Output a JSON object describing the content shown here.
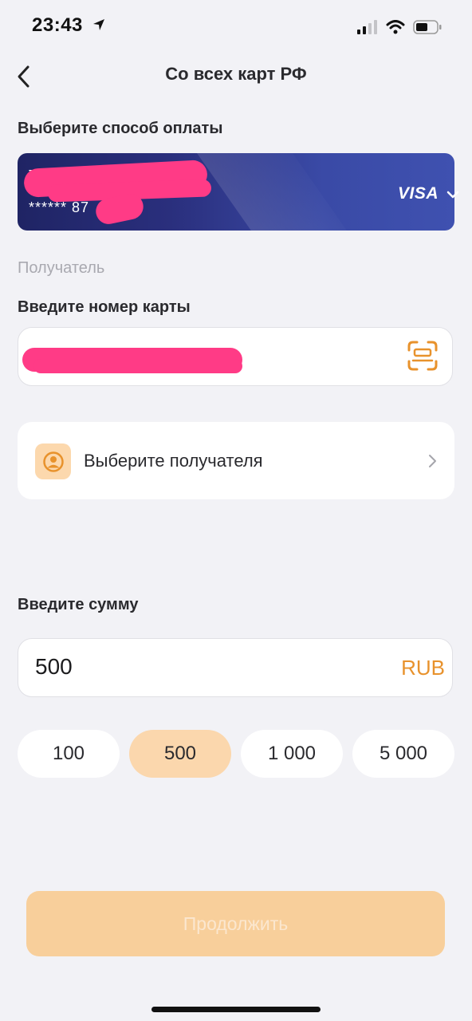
{
  "status_bar": {
    "time": "23:43"
  },
  "header": {
    "title": "Со всех карт РФ"
  },
  "payment": {
    "label": "Выберите способ оплаты",
    "card_holder": "Т",
    "card_number": "****** 87",
    "card_brand": "VISA"
  },
  "recipient": {
    "section_label": "Получатель",
    "card_label": "Введите номер карты",
    "card_value": "4",
    "choose_label": "Выберите получателя"
  },
  "amount": {
    "label": "Введите сумму",
    "value": "500",
    "currency": "RUB",
    "presets": [
      "100",
      "500",
      "1 000",
      "5 000"
    ],
    "selected": "500"
  },
  "actions": {
    "continue_label": "Продолжить"
  },
  "colors": {
    "accent": "#e8922c",
    "accent_light": "#fbd7ad",
    "card_gradient_start": "#1f2464",
    "card_gradient_end": "#3f51b0",
    "background": "#f2f2f6"
  }
}
